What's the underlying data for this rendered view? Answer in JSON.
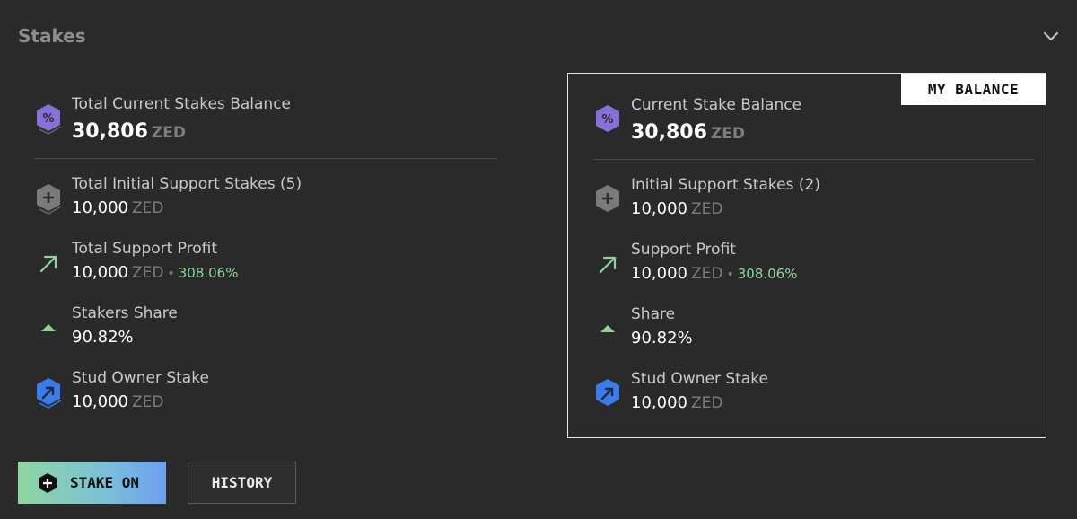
{
  "header": {
    "title": "Stakes"
  },
  "total": {
    "current_balance": {
      "label": "Total Current Stakes Balance",
      "value": "30,806",
      "unit": "ZED"
    },
    "initial_support": {
      "label": "Total Initial Support Stakes (5)",
      "value": "10,000",
      "unit": "ZED"
    },
    "support_profit": {
      "label": "Total Support Profit",
      "value": "10,000",
      "unit": "ZED",
      "separator": "•",
      "percent": "308.06%"
    },
    "stakers_share": {
      "label": "Stakers Share",
      "value": "90.82%"
    },
    "stud_owner": {
      "label": "Stud Owner Stake",
      "value": "10,000",
      "unit": "ZED"
    }
  },
  "mine": {
    "badge": "MY BALANCE",
    "current_balance": {
      "label": "Current Stake Balance",
      "value": "30,806",
      "unit": "ZED"
    },
    "initial_support": {
      "label": "Initial Support Stakes (2)",
      "value": "10,000",
      "unit": "ZED"
    },
    "support_profit": {
      "label": "Support Profit",
      "value": "10,000",
      "unit": "ZED",
      "separator": "•",
      "percent": "308.06%"
    },
    "share": {
      "label": "Share",
      "value": "90.82%"
    },
    "stud_owner": {
      "label": "Stud Owner Stake",
      "value": "10,000",
      "unit": "ZED"
    }
  },
  "actions": {
    "stake_on": "STAKE ON",
    "history": "HISTORY"
  },
  "icons": {
    "balance": "percent-hexagon-icon",
    "initial": "plus-hexagon-icon",
    "profit": "arrow-up-right-icon",
    "share": "triangle-up-icon",
    "stud": "stud-owner-hexagon-icon",
    "collapse": "chevron-down-icon"
  },
  "colors": {
    "accent_green": "#8fd39a",
    "purple": "#8b6fd8",
    "blue": "#3b7ce8",
    "gray_icon": "#7a7a7a"
  }
}
